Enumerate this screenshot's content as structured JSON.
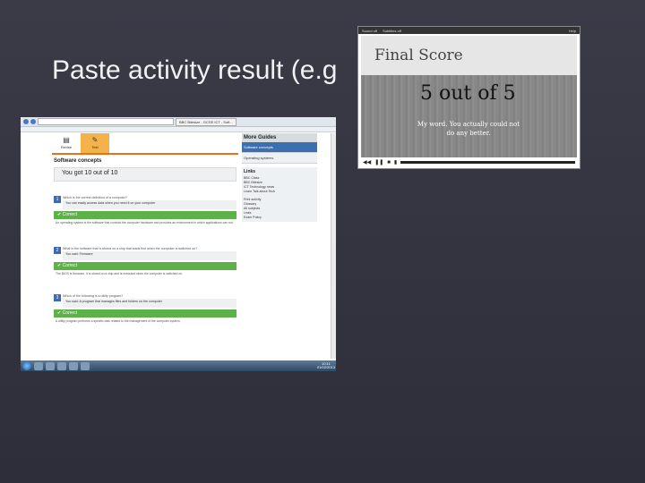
{
  "slide": {
    "title": "Paste activity result (e.g"
  },
  "browser": {
    "address": "http://www.bbc.co.uk/schools/gcsebitesize/ict/software/0softwarerev_test.shtml",
    "tab_label": "BBC Bitesize - GCSE ICT - Soft..."
  },
  "page": {
    "tabs": [
      {
        "label": "Revise",
        "icon": "book-icon"
      },
      {
        "label": "Test",
        "icon": "test-icon"
      }
    ],
    "section_title": "Software concepts",
    "score": "You got 10 out of 10",
    "questions": [
      {
        "num": "1",
        "question": "Which is the correct definition of a computer?",
        "answer": "You can easily access data when you need it on your computer",
        "result": "✔ Correct",
        "explanation": "An operating system is the software that controls the computer hardware and provides an environment in which applications can run."
      },
      {
        "num": "2",
        "question": "What is the software that is stored on a chip that loads first when the computer is switched on?",
        "answer": "You said: Firmware",
        "result": "✔ Correct",
        "explanation": "The BIOS is firmware. It is stored on a chip and is executed when the computer is switched on."
      },
      {
        "num": "3",
        "question": "Which of the following is a utility program?",
        "answer": "You said: A program that manages files and folders on the computer",
        "result": "✔ Correct",
        "explanation": "A utility program performs a specific task related to the management of the computer system."
      }
    ],
    "more_guides_title": "More Guides",
    "guides": [
      {
        "label": "Software concepts",
        "active": true
      },
      {
        "label": "Operating systems",
        "active": false
      }
    ],
    "links_title": "Links",
    "links": [
      "BBC Class",
      "BBC Bitesize",
      "ICT Technology news",
      "Learn Talk about Tech"
    ],
    "tools": [
      "Print activity",
      "Glossary",
      "All subjects",
      "Links",
      "Exam Policy"
    ]
  },
  "taskbar": {
    "time": "10:11",
    "date": "01/02/2013"
  },
  "video": {
    "top_left": "Sound off",
    "top_mid": "Subtitles off",
    "help": "Help",
    "heading": "Final Score",
    "score": "5 out of 5",
    "message": "My word. You actually could not do any better."
  }
}
